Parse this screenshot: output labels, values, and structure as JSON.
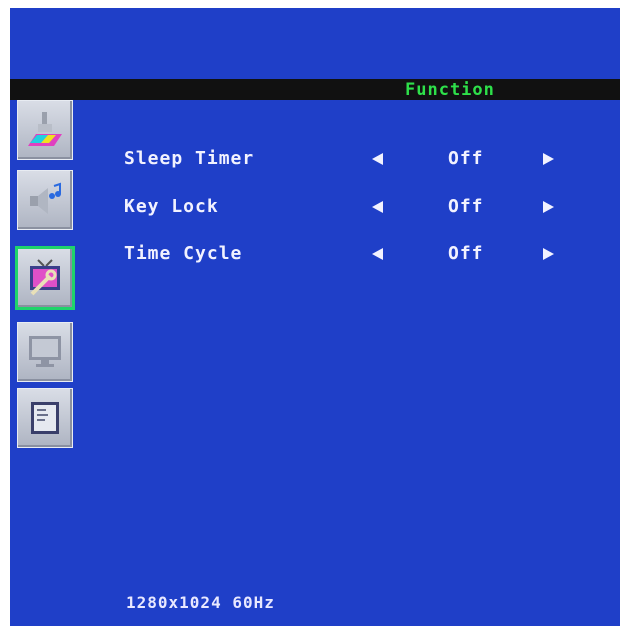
{
  "header": {
    "title": "Function"
  },
  "sidebar": {
    "items": [
      {
        "icon": "brush-color-icon",
        "active": false
      },
      {
        "icon": "speaker-music-icon",
        "active": false
      },
      {
        "icon": "tv-wrench-icon",
        "active": true
      },
      {
        "icon": "monitor-icon",
        "active": false
      },
      {
        "icon": "document-icon",
        "active": false
      }
    ]
  },
  "menu": {
    "items": [
      {
        "label": "Sleep Timer",
        "value": "Off"
      },
      {
        "label": "Key Lock",
        "value": "Off"
      },
      {
        "label": "Time Cycle",
        "value": "Off"
      }
    ]
  },
  "status": {
    "resolution": "1280x1024  60Hz"
  },
  "colors": {
    "background": "#1f3fc8",
    "title_bar": "#111111",
    "title_text": "#2ee04a",
    "active_border": "#1fd46b",
    "text": "#f2f2ff"
  }
}
